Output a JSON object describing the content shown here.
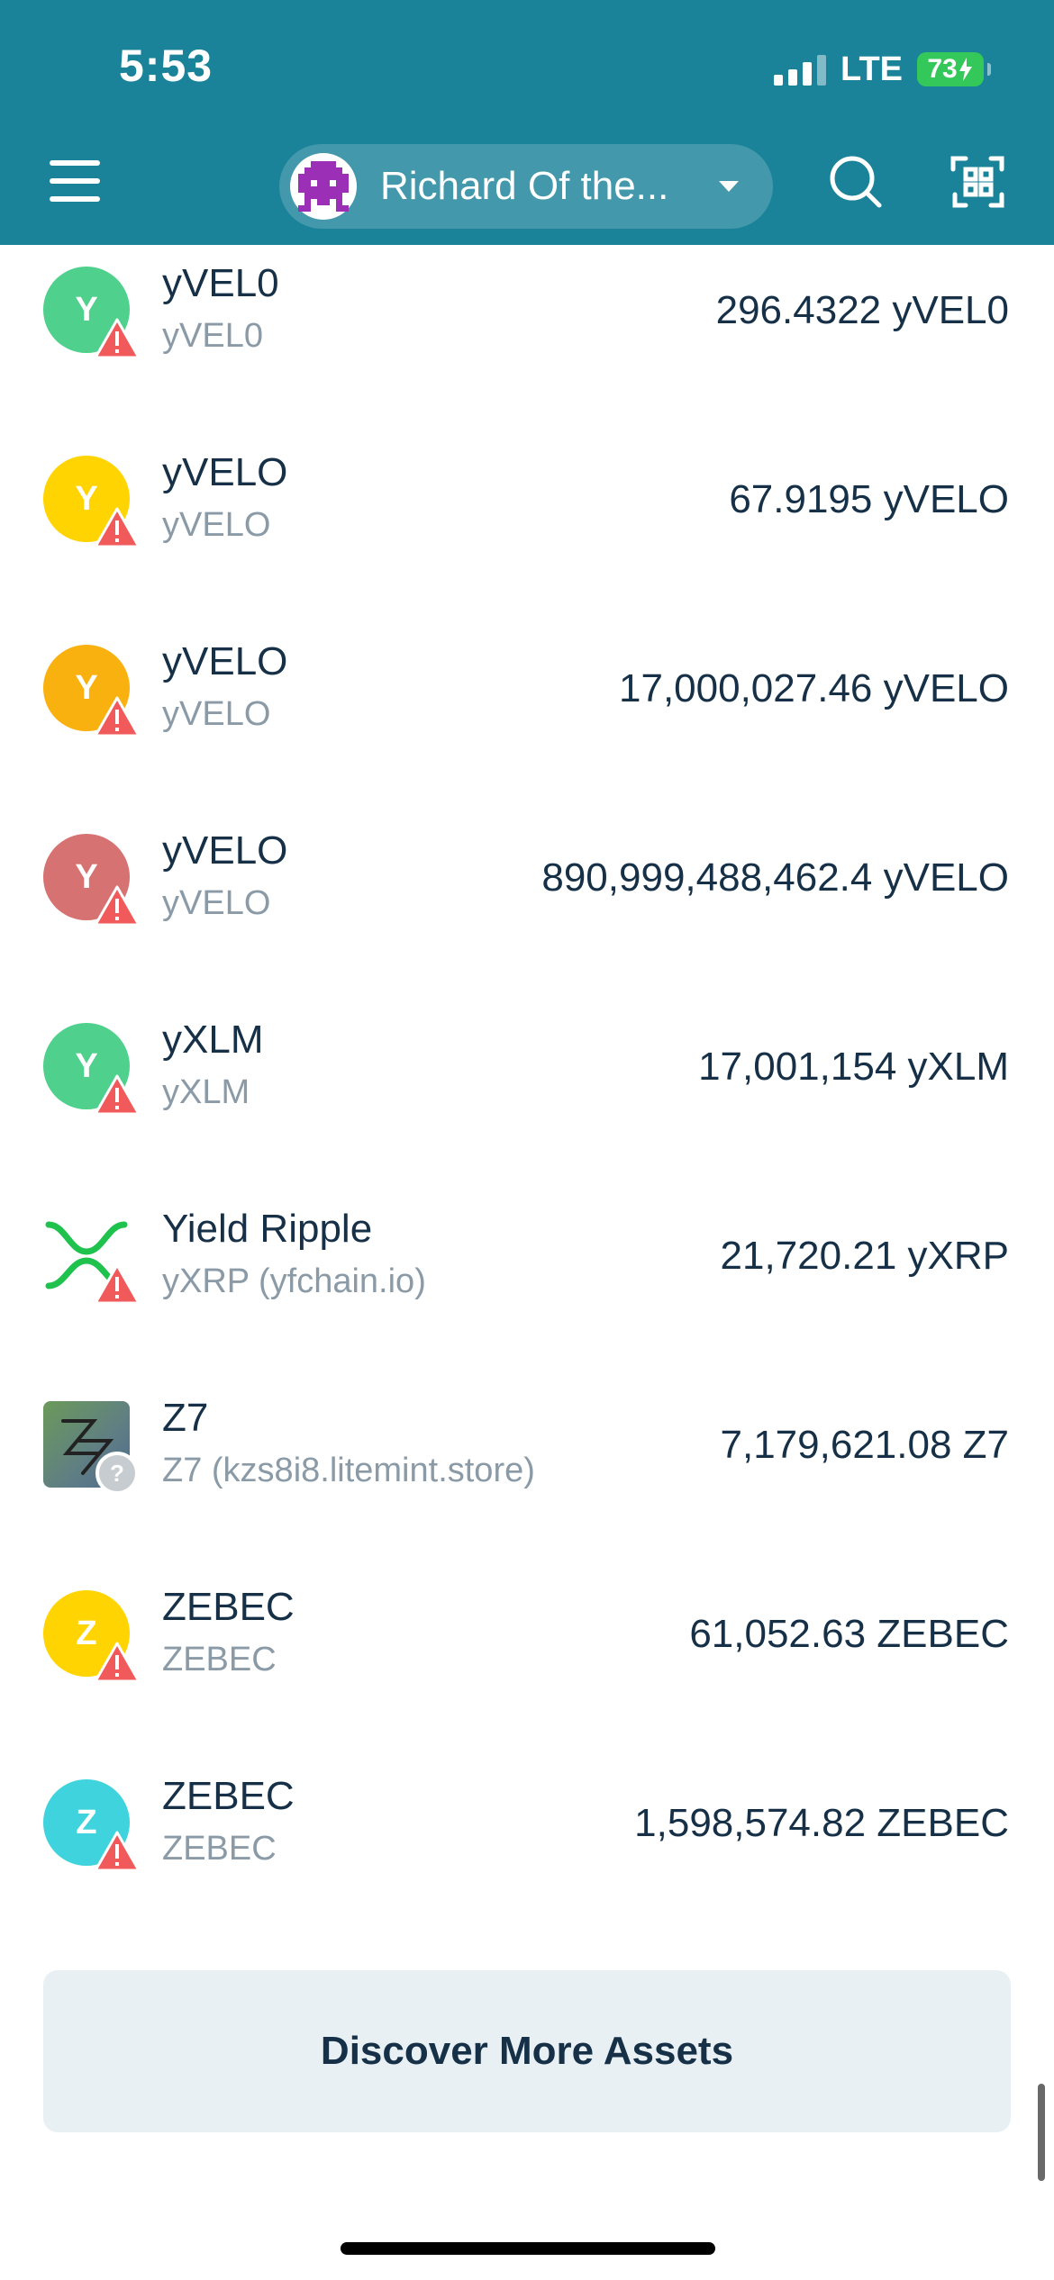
{
  "status_bar": {
    "time": "5:53",
    "network": "LTE",
    "battery": "73"
  },
  "header": {
    "account_name": "Richard Of the...",
    "icons": {
      "menu": "hamburger-menu-icon",
      "avatar": "pixel-avatar-icon",
      "dropdown": "chevron-down-icon",
      "search": "search-icon",
      "scan": "qr-scan-icon"
    }
  },
  "assets": [
    {
      "letter": "Y",
      "name": "yVEL0",
      "code": "yVEL0",
      "balance": "296.4322 yVEL0",
      "color": "#4fd08c",
      "badge": "warning"
    },
    {
      "letter": "Y",
      "name": "yVELO",
      "code": "yVELO",
      "balance": "67.9195 yVELO",
      "color": "#ffd400",
      "badge": "warning"
    },
    {
      "letter": "Y",
      "name": "yVELO",
      "code": "yVELO",
      "balance": "17,000,027.46 yVELO",
      "color": "#f8b10e",
      "badge": "warning"
    },
    {
      "letter": "Y",
      "name": "yVELO",
      "code": "yVELO",
      "balance": "890,999,488,462.4 yVELO",
      "color": "#d77272",
      "badge": "warning"
    },
    {
      "letter": "Y",
      "name": "yXLM",
      "code": "yXLM",
      "balance": "17,001,154 yXLM",
      "color": "#4fd08c",
      "badge": "warning"
    },
    {
      "letter": "",
      "name": "Yield Ripple",
      "code": "yXRP (yfchain.io)",
      "balance": "21,720.21 yXRP",
      "color": "#ffffff",
      "badge": "warning",
      "icon": "ripple-x-logo-icon"
    },
    {
      "letter": "",
      "name": "Z7",
      "code": "Z7 (kzs8i8.litemint.store)",
      "balance": "7,179,621.08 Z7",
      "color": "#6b8a6a",
      "badge": "unknown",
      "icon": "z7-logo-icon"
    },
    {
      "letter": "Z",
      "name": "ZEBEC",
      "code": "ZEBEC",
      "balance": "61,052.63 ZEBEC",
      "color": "#ffd400",
      "badge": "warning"
    },
    {
      "letter": "Z",
      "name": "ZEBEC",
      "code": "ZEBEC",
      "balance": "1,598,574.82 ZEBEC",
      "color": "#3fd3dd",
      "badge": "warning"
    }
  ],
  "discover_button": "Discover More Assets",
  "colors": {
    "header_bg": "#1a8399",
    "text_primary": "#163047",
    "text_secondary": "#8a9aa6",
    "warning": "#f05a5a",
    "button_bg": "#e8f0f3"
  }
}
